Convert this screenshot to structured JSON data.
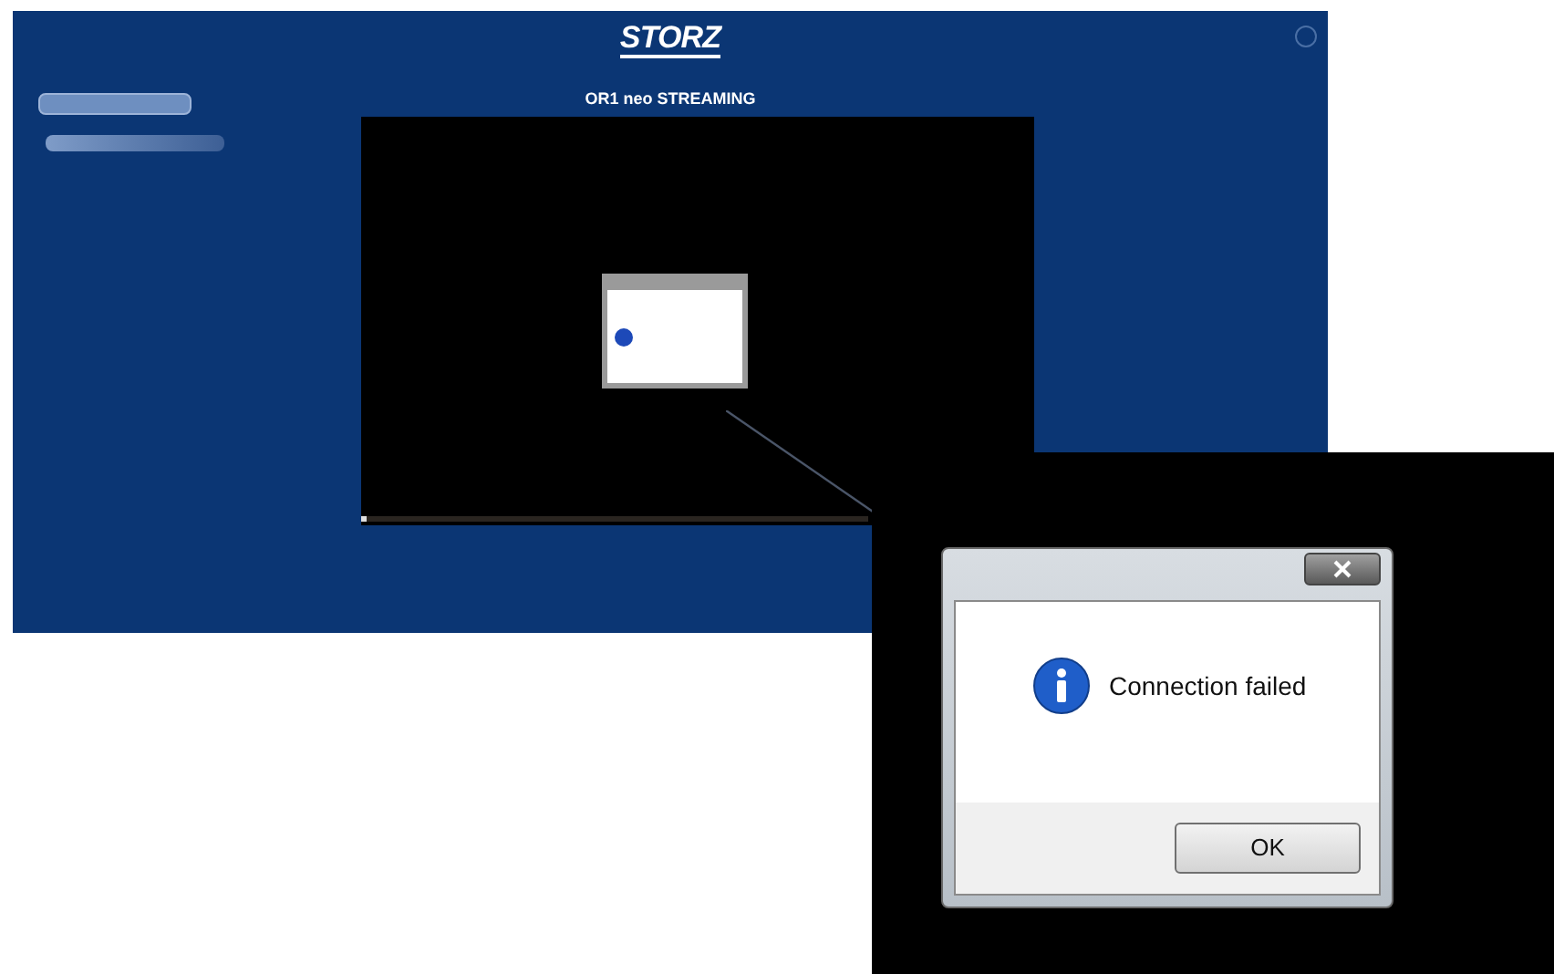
{
  "app": {
    "logo": "STORZ",
    "title": "OR1 neo STREAMING",
    "video": {
      "level": 0.01
    }
  },
  "callout": {
    "dialog": {
      "message": "Connection failed",
      "button": "OK"
    }
  }
}
